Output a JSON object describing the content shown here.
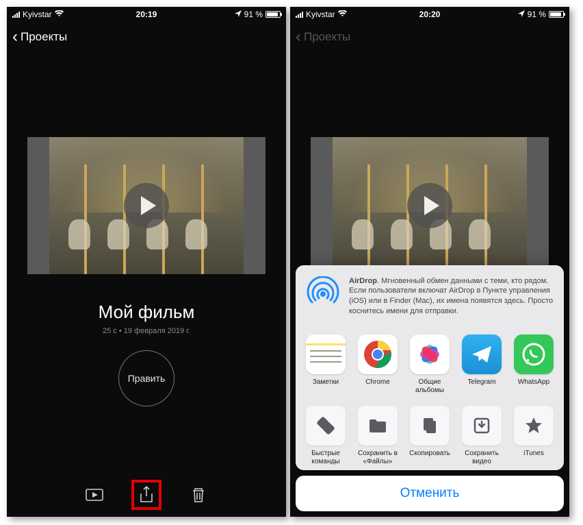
{
  "left": {
    "status": {
      "carrier": "Kyivstar",
      "time": "20:19",
      "batt": "91 %"
    },
    "back": "Проекты",
    "title": "Мой фильм",
    "meta": "25 с • 19 февраля 2019 г.",
    "edit": "Править"
  },
  "right": {
    "status": {
      "carrier": "Kyivstar",
      "time": "20:20",
      "batt": "91 %"
    },
    "back": "Проекты",
    "airdrop": {
      "label": "AirDrop",
      "text": ". Мгновенный обмен данными с теми, кто рядом. Если пользователи включат AirDrop в Пункте управления (iOS) или в Finder (Mac), их имена появятся здесь. Просто коснитесь имени для отправки."
    },
    "apps": [
      {
        "label": "Заметки"
      },
      {
        "label": "Chrome"
      },
      {
        "label": "Общие альбомы"
      },
      {
        "label": "Telegram"
      },
      {
        "label": "WhatsApp"
      }
    ],
    "actions": [
      {
        "label": "Быстрые команды"
      },
      {
        "label": "Сохранить в «Файлы»"
      },
      {
        "label": "Скопировать"
      },
      {
        "label": "Сохранить видео"
      },
      {
        "label": "iTunes"
      }
    ],
    "cancel": "Отменить"
  }
}
